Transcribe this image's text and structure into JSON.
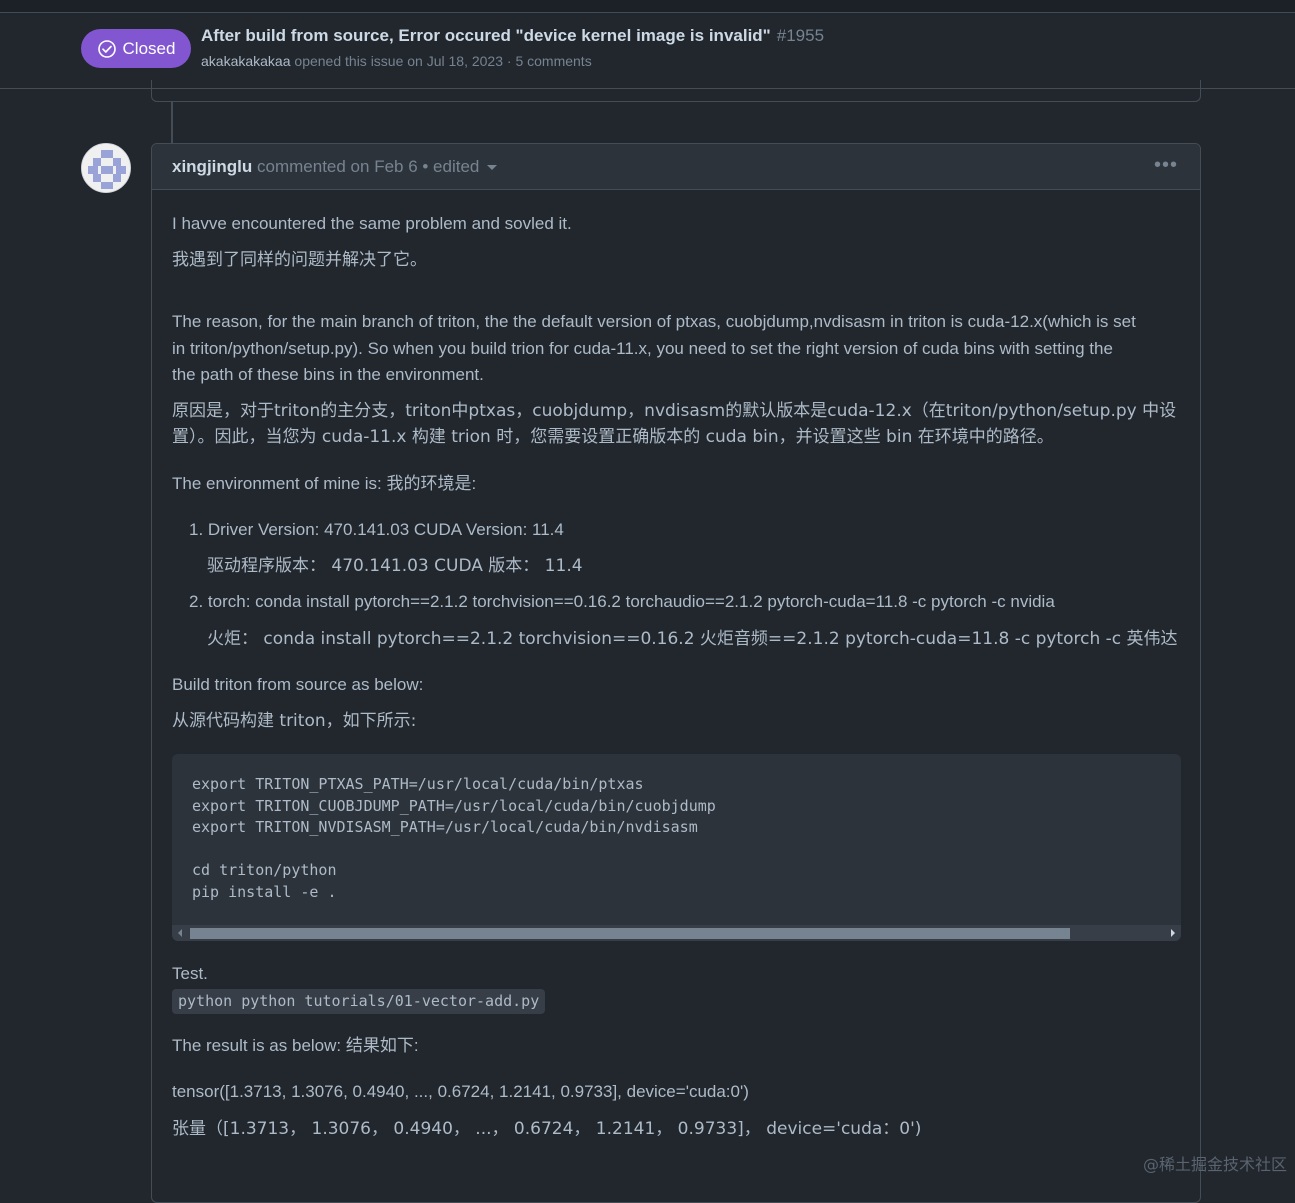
{
  "issue": {
    "status": "Closed",
    "title": "After build from source, Error occured \"device kernel image is invalid\"",
    "number": "#1955",
    "author": "akakakakakaa",
    "meta": "opened this issue on Jul 18, 2023 · 5 comments"
  },
  "comment": {
    "author": "xingjinglu",
    "meta": "commented on Feb 6 • edited",
    "lines": {
      "l1": "I havve encountered the same problem and sovled it.",
      "l2": "我遇到了同样的问题并解决了它。",
      "l3": "The reason, for the main branch of triton, the the default version of ptxas, cuobjdump,nvdisasm in triton is cuda-12.x(which is set",
      "l4": "in triton/python/setup.py). So when you build trion for cuda-11.x, you need to set the right version of cuda bins with setting the",
      "l5": "the path of these bins in the environment.",
      "l6": "原因是，对于triton的主分支，triton中ptxas，cuobjdump，nvdisasm的默认版本是cuda-12.x（在triton/python/setup.py 中设",
      "l7": "置）。因此，当您为 cuda-11.x 构建 trion 时，您需要设置正确版本的 cuda bin，并设置这些 bin 在环境中的路径。",
      "l8": "The environment of mine is: 我的环境是:",
      "li1": "1. Driver Version: 470.141.03 CUDA Version: 11.4",
      "li1b": "驱动程序版本： 470.141.03 CUDA 版本： 11.4",
      "li2": "2. torch: conda install pytorch==2.1.2 torchvision==0.16.2 torchaudio==2.1.2 pytorch-cuda=11.8 -c pytorch -c nvidia",
      "li2b": "火炬： conda install pytorch==2.1.2 torchvision==0.16.2 火炬音频==2.1.2 pytorch-cuda=11.8 -c pytorch -c 英伟达",
      "l9": "Build triton from source as below:",
      "l10": "从源代码构建 triton，如下所示:",
      "code": "export TRITON_PTXAS_PATH=/usr/local/cuda/bin/ptxas\nexport TRITON_CUOBJDUMP_PATH=/usr/local/cuda/bin/cuobjdump\nexport TRITON_NVDISASM_PATH=/usr/local/cuda/bin/nvdisasm\n\ncd triton/python\npip install -e .",
      "l11": "Test.",
      "inline_code": "python python tutorials/01-vector-add.py",
      "l12": "The result is as below: 结果如下:",
      "l13": "tensor([1.3713, 1.3076, 0.4940, ..., 0.6724, 1.2141, 0.9733], device='cuda:0')",
      "l14": "张量（[1.3713， 1.3076， 0.4940， ...， 0.6724， 1.2141， 0.9733]， device='cuda：0')"
    }
  },
  "watermark": "@稀土掘金技术社区",
  "colors": {
    "closed_badge": "#8256d0",
    "background": "#22272e"
  },
  "icons": {
    "status": "check-circle-icon",
    "menu": "kebab-icon"
  }
}
